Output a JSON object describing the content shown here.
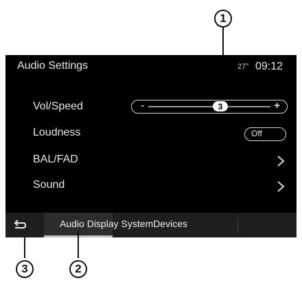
{
  "callouts": {
    "one": "1",
    "two": "2",
    "three": "3"
  },
  "header": {
    "title": "Audio Settings",
    "temperature": "27°",
    "time": "09:12"
  },
  "rows": {
    "vol_speed": {
      "label": "Vol/Speed",
      "minus": "-",
      "plus": "+",
      "value": "3"
    },
    "loudness": {
      "label": "Loudness",
      "toggle": "Off"
    },
    "bal_fad": {
      "label": "BAL/FAD"
    },
    "sound": {
      "label": "Sound"
    }
  },
  "tabs": {
    "audio": "Audio",
    "display": "Display",
    "system": "System",
    "devices": "Devices"
  },
  "icons": {
    "back": "return-arrow-icon",
    "chevron": "chevron-right-icon"
  }
}
